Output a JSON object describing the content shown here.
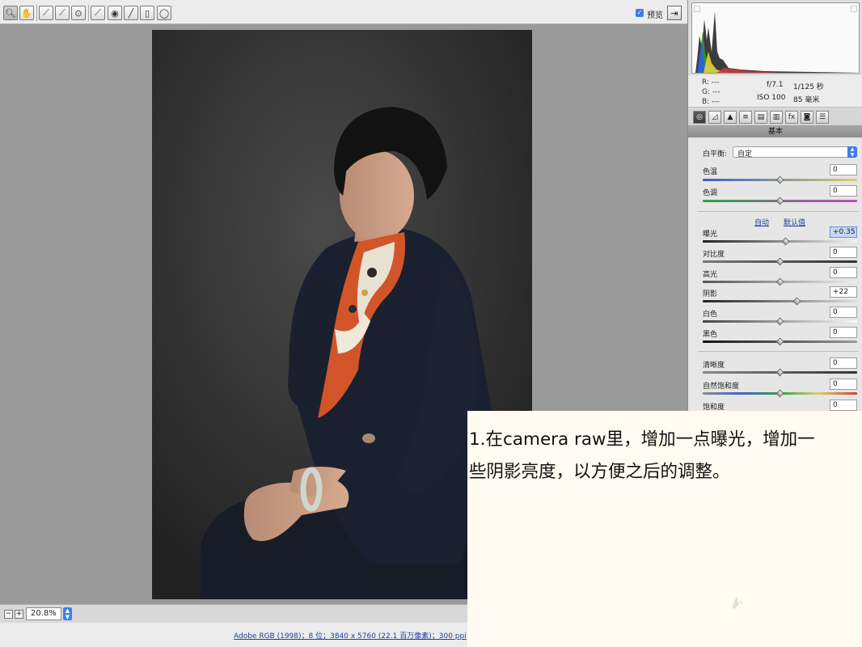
{
  "toolbar": {
    "tools": [
      "zoom-icon",
      "hand-icon",
      "white-balance-icon",
      "color-sampler-icon",
      "targeted-adjustment-icon",
      "crop-icon",
      "spot-removal-icon",
      "red-eye-icon",
      "adjustment-brush-icon",
      "graduated-filter-icon",
      "radial-filter-icon"
    ],
    "preview_label": "预览",
    "preview_checked": true
  },
  "canvas": {
    "zoom_value": "20.8%"
  },
  "footer": {
    "workflow_link": "Adobe RGB (1998)；8 位；3840 x 5760 (22.1 百万像素)；300 ppi"
  },
  "readout": {
    "r": "R:  ---",
    "g": "G:  ---",
    "b": "B:  ---",
    "aperture": "f/7.1",
    "shutter": "1/125 秒",
    "iso": "ISO 100",
    "focal": "85 毫米"
  },
  "panel": {
    "title": "基本",
    "tabs": [
      "basic-tab-icon",
      "tone-curve-tab-icon",
      "detail-tab-icon",
      "hsl-tab-icon",
      "split-toning-tab-icon",
      "lens-corrections-tab-icon",
      "effects-tab-icon",
      "camera-calibration-tab-icon",
      "presets-tab-icon"
    ],
    "fx_label": "fx",
    "white_balance": {
      "label": "白平衡:",
      "value": "自定"
    },
    "temperature": {
      "label": "色温",
      "value": "0"
    },
    "tint": {
      "label": "色调",
      "value": "0"
    },
    "auto_link": "自动",
    "default_link": "默认值",
    "exposure": {
      "label": "曝光",
      "value": "+0.35"
    },
    "contrast": {
      "label": "对比度",
      "value": "0"
    },
    "highlights": {
      "label": "高光",
      "value": "0"
    },
    "shadows": {
      "label": "阴影",
      "value": "+22"
    },
    "whites": {
      "label": "白色",
      "value": "0"
    },
    "blacks": {
      "label": "黑色",
      "value": "0"
    },
    "clarity": {
      "label": "清晰度",
      "value": "0"
    },
    "vibrance": {
      "label": "自然饱和度",
      "value": "0"
    },
    "saturation": {
      "label": "饱和度",
      "value": "0"
    },
    "slider_positions": {
      "temperature": 0.5,
      "tint": 0.5,
      "exposure": 0.535,
      "contrast": 0.5,
      "highlights": 0.5,
      "shadows": 0.61,
      "whites": 0.5,
      "blacks": 0.5,
      "clarity": 0.5,
      "vibrance": 0.5,
      "saturation": 0.5
    }
  },
  "caption": {
    "line1": "1.在camera raw里，增加一点曝光，增加一",
    "line2": "些阴影亮度，以方便之后的调整。"
  },
  "colors": {
    "accent": "#3d7ee8",
    "link": "#1f3f99",
    "scarf_orange": "#d2552a",
    "jacket_navy": "#1b2030"
  }
}
